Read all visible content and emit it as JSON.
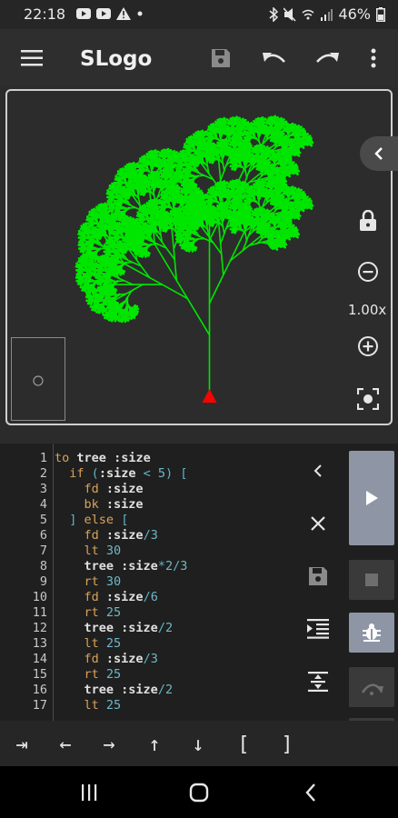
{
  "status_bar": {
    "time": "22:18",
    "battery": "46%",
    "icons": [
      "youtube-icon",
      "youtube-icon",
      "warning-icon",
      "dot-icon",
      "bluetooth-icon",
      "mute-icon",
      "wifi-icon",
      "signal-icon",
      "battery-icon"
    ]
  },
  "app_bar": {
    "title": "SLogo",
    "icons": [
      "menu-icon",
      "save-icon",
      "undo-icon",
      "redo-icon",
      "more-vert-icon"
    ]
  },
  "canvas": {
    "zoom": "1.00x",
    "tree_color": "#00e600",
    "turtle_color": "#ff0000",
    "icons": [
      "chevron-left-icon",
      "lock-icon",
      "zoom-out-icon",
      "zoom-in-icon",
      "fit-screen-icon"
    ]
  },
  "editor": {
    "lines": [
      {
        "n": "1",
        "code": "to tree :size"
      },
      {
        "n": "2",
        "code": "  if (:size < 5) ["
      },
      {
        "n": "3",
        "code": "    fd :size"
      },
      {
        "n": "4",
        "code": "    bk :size"
      },
      {
        "n": "5",
        "code": "  ] else ["
      },
      {
        "n": "6",
        "code": "    fd :size/3"
      },
      {
        "n": "7",
        "code": "    lt 30"
      },
      {
        "n": "8",
        "code": "    tree :size*2/3"
      },
      {
        "n": "9",
        "code": "    rt 30"
      },
      {
        "n": "10",
        "code": "    fd :size/6"
      },
      {
        "n": "11",
        "code": "    rt 25"
      },
      {
        "n": "12",
        "code": "    tree :size/2"
      },
      {
        "n": "13",
        "code": "    lt 25"
      },
      {
        "n": "14",
        "code": "    fd :size/3"
      },
      {
        "n": "15",
        "code": "    rt 25"
      },
      {
        "n": "16",
        "code": "    tree :size/2"
      },
      {
        "n": "17",
        "code": "    lt 25"
      }
    ],
    "side_icons": [
      "chevron-left-icon",
      "close-icon",
      "save-icon",
      "indent-icon",
      "format-icon"
    ],
    "control_icons": [
      "play-icon",
      "stop-icon",
      "debug-icon",
      "step-over-icon",
      "step-icon"
    ]
  },
  "keyboard_toolbar": {
    "keys": [
      "⇥",
      "←",
      "→",
      "↑",
      "↓",
      "[",
      "]"
    ]
  }
}
